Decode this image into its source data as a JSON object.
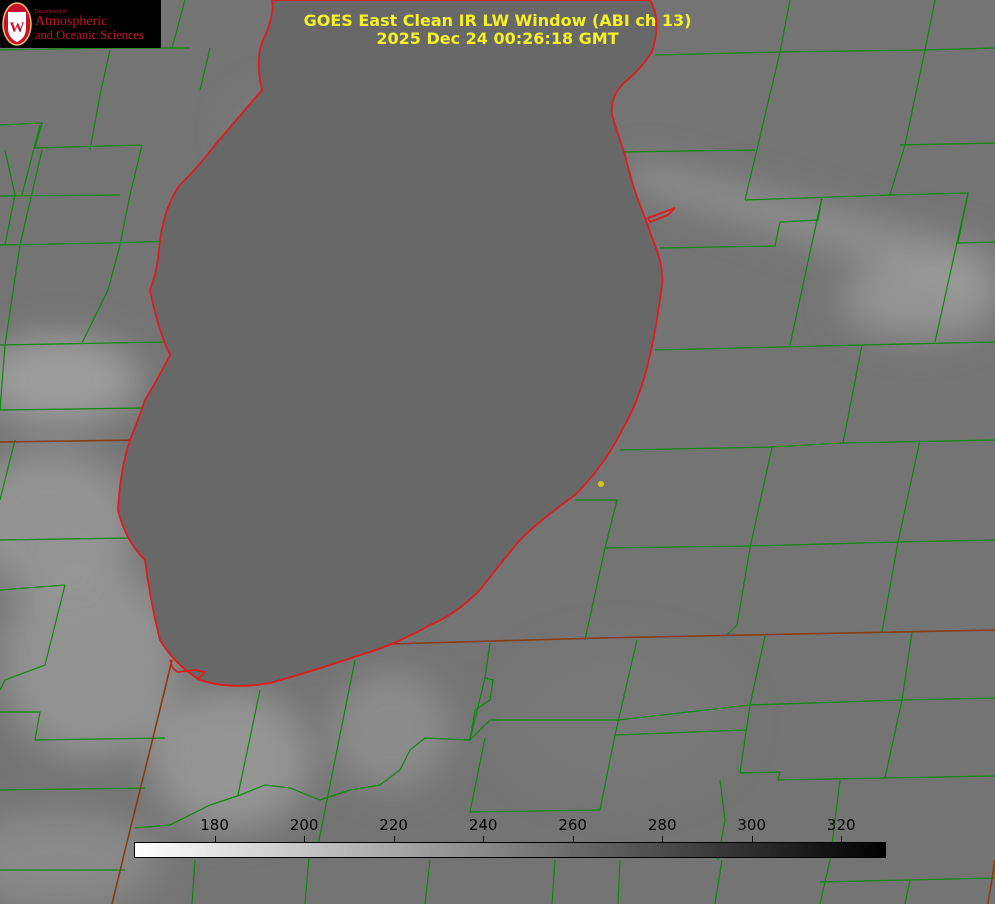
{
  "logo": {
    "dept_label": "Department of",
    "line1": "Atmospheric",
    "line2": "and Oceanic Sciences",
    "seal_letter": "W",
    "color": "#c8102e"
  },
  "title": {
    "line1": "GOES East Clean IR LW Window (ABI ch 13)",
    "line2": "2025 Dec 24 00:26:18 GMT",
    "color": "#f5f028"
  },
  "colorbar": {
    "min": 162,
    "max": 330,
    "ticks": [
      180,
      200,
      220,
      240,
      260,
      280,
      300,
      320
    ],
    "colormap": "white-to-black",
    "colors": {
      "low": "#ffffff",
      "high": "#000000"
    }
  },
  "map_colors": {
    "county_lines": "#0a8a0a",
    "shoreline": "#e11b1b",
    "state_lines": "#8b3a0a",
    "marker": "#d9c21a",
    "lake": "#686868",
    "land": "#747474"
  }
}
